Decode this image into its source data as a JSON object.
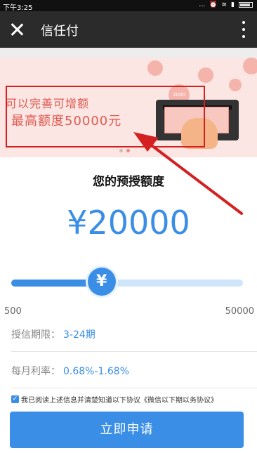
{
  "status_bar": {
    "time": "下午3:25",
    "icons": [
      "mute-icon",
      "alarm-icon",
      "wifi-icon",
      "signal-icon",
      "battery-icon"
    ]
  },
  "nav": {
    "title": "信任付",
    "close_icon": "close-icon",
    "more_icon": "more-vertical-icon"
  },
  "banner": {
    "line1": "可以完善可增额",
    "line2": "最高额度50000元",
    "coin_label": "2000",
    "slide_count": 2,
    "active_slide": 2
  },
  "section_title": "您的预授额度",
  "amount": "¥20000",
  "slider": {
    "icon": "yen-icon",
    "min_label": "500",
    "max_label": "50000",
    "value_fraction": 0.39
  },
  "rows": {
    "period_label": "授信期限：",
    "period_value": "3-24期",
    "rate_label": "每月利率：",
    "rate_value": "0.68%-1.68%"
  },
  "agreement": {
    "checked": true,
    "text": "我已阅读上述信息并清楚知道以下协议《微信以下期以务协议》"
  },
  "apply_button": "立即申请",
  "colors": {
    "accent": "#3a8ee6",
    "nav_bg": "#2b2b2b",
    "annotation_red": "#d42020"
  }
}
